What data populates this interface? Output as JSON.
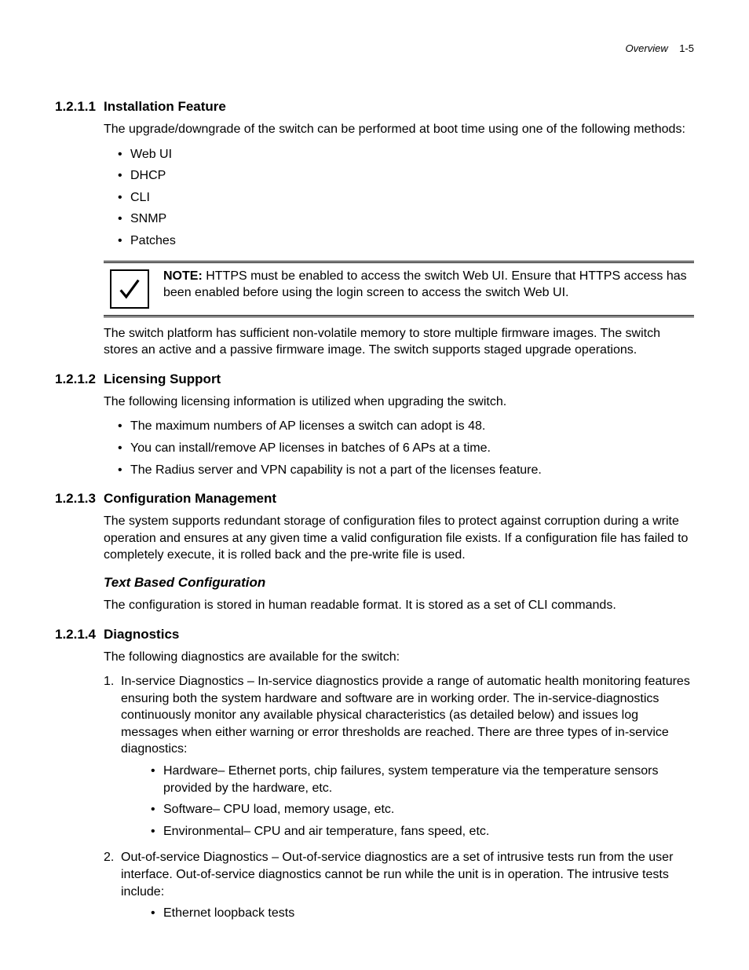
{
  "header": {
    "chapter": "Overview",
    "page": "1-5"
  },
  "sections": {
    "s1": {
      "num": "1.2.1.1",
      "title": "Installation Feature",
      "intro": "The upgrade/downgrade of the switch can be performed at boot time using one of the following methods:",
      "bullets": [
        "Web UI",
        "DHCP",
        "CLI",
        "SNMP",
        "Patches"
      ],
      "note_label": "NOTE:",
      "note_text": " HTTPS must be enabled to access the switch Web UI. Ensure that HTTPS access has been enabled before using the login screen to access the switch Web UI.",
      "after_note": "The switch platform has sufficient non-volatile memory to store multiple firmware images. The switch stores an active and a passive firmware image. The switch supports staged upgrade operations."
    },
    "s2": {
      "num": "1.2.1.2",
      "title": "Licensing Support",
      "intro": "The following licensing information is utilized when upgrading the switch.",
      "bullets": [
        "The maximum numbers of AP licenses a switch can adopt is 48.",
        "You can install/remove AP licenses in batches of 6 APs at a time.",
        "The Radius server and VPN capability is not a part of the licenses feature."
      ]
    },
    "s3": {
      "num": "1.2.1.3",
      "title": "Configuration Management",
      "para": "The system supports redundant storage of configuration files to protect against corruption during a write operation and ensures at any given time a valid configuration file exists. If a configuration file has failed to completely execute, it is rolled back and the pre-write file is used.",
      "sub_title": "Text Based Configuration",
      "sub_para": "The configuration is stored in human readable format. It is stored as a set of CLI commands."
    },
    "s4": {
      "num": "1.2.1.4",
      "title": "Diagnostics",
      "intro": "The following diagnostics are available for the switch:",
      "items": [
        {
          "text": "In-service Diagnostics – In-service diagnostics provide a range of automatic health monitoring features ensuring both the system hardware and software are in working order. The in-service-diagnostics continuously monitor any available physical characteristics (as detailed below) and issues log messages when either warning or error thresholds are reached. There are three types of in-service diagnostics:",
          "sub": [
            "Hardware– Ethernet ports, chip failures, system temperature via the temperature sensors provided by the hardware, etc.",
            "Software– CPU load, memory usage, etc.",
            "Environmental– CPU and air temperature, fans speed, etc."
          ]
        },
        {
          "text": "Out-of-service Diagnostics – Out-of-service diagnostics are a set of intrusive tests run from the user interface. Out-of-service diagnostics cannot be run while the unit is in operation. The intrusive tests include:",
          "sub": [
            "Ethernet loopback tests"
          ]
        }
      ]
    }
  }
}
